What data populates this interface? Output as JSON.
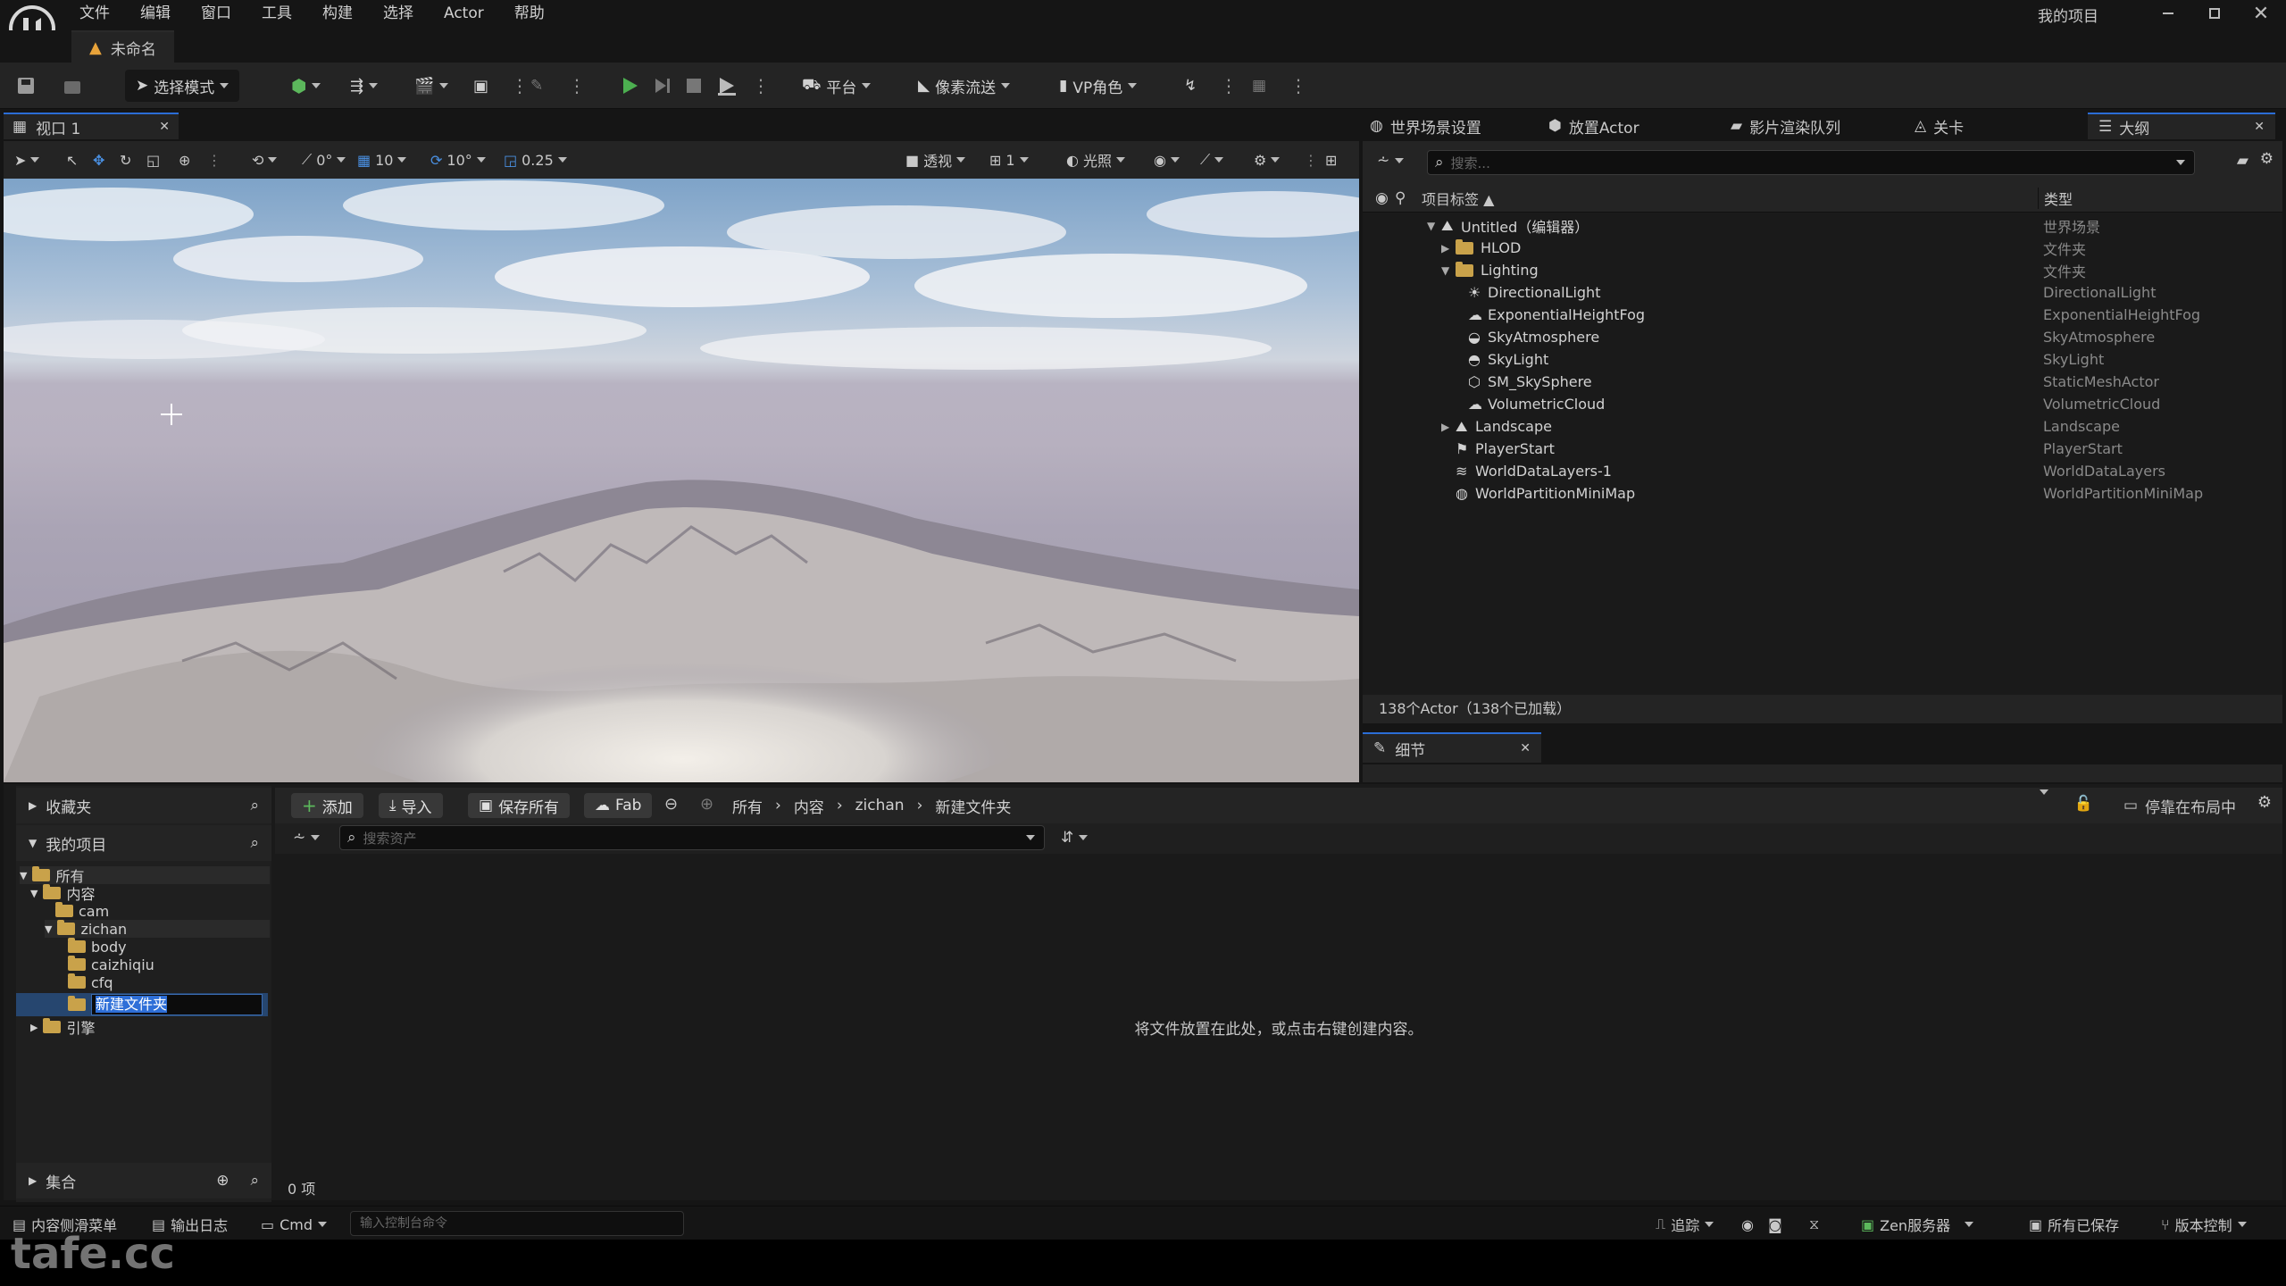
{
  "app": {
    "project_name": "我的项目",
    "document_tab": "未命名"
  },
  "menu": [
    "文件",
    "编辑",
    "窗口",
    "工具",
    "构建",
    "选择",
    "Actor",
    "帮助"
  ],
  "toolbar": {
    "select_mode": "选择模式",
    "platform": "平台",
    "pixel_streaming": "像素流送",
    "vp_role": "VP角色"
  },
  "viewport": {
    "tab_label": "视口 1",
    "snap_angle": "0°",
    "grid_size": "10",
    "rotation_snap": "10°",
    "scale_snap": "0.25",
    "view_mode": "透视",
    "layout_count": "1",
    "lighting": "光照"
  },
  "right_tabs": [
    "世界场景设置",
    "放置Actor",
    "影片渲染队列",
    "关卡",
    "大纲"
  ],
  "outliner": {
    "search_placeholder": "搜索...",
    "col_label": "项目标签 ▲",
    "col_type": "类型",
    "rows": [
      {
        "label": "Untitled（编辑器）",
        "type": "世界场景",
        "icon": "world-icon",
        "indent": 0
      },
      {
        "label": "HLOD",
        "type": "文件夹",
        "icon": "folder-icon",
        "indent": 1
      },
      {
        "label": "Lighting",
        "type": "文件夹",
        "icon": "folder-icon",
        "indent": 1
      },
      {
        "label": "DirectionalLight",
        "type": "DirectionalLight",
        "icon": "sun-icon",
        "indent": 2
      },
      {
        "label": "ExponentialHeightFog",
        "type": "ExponentialHeightFog",
        "icon": "fog-icon",
        "indent": 2
      },
      {
        "label": "SkyAtmosphere",
        "type": "SkyAtmosphere",
        "icon": "atmosphere-icon",
        "indent": 2
      },
      {
        "label": "SkyLight",
        "type": "SkyLight",
        "icon": "skylight-icon",
        "indent": 2
      },
      {
        "label": "SM_SkySphere",
        "type": "StaticMeshActor",
        "icon": "mesh-icon",
        "indent": 2
      },
      {
        "label": "VolumetricCloud",
        "type": "VolumetricCloud",
        "icon": "cloud-icon",
        "indent": 2
      },
      {
        "label": "Landscape",
        "type": "Landscape",
        "icon": "landscape-icon",
        "indent": 1
      },
      {
        "label": "PlayerStart",
        "type": "PlayerStart",
        "icon": "flag-icon",
        "indent": 1
      },
      {
        "label": "WorldDataLayers-1",
        "type": "WorldDataLayers",
        "icon": "layers-icon",
        "indent": 1
      },
      {
        "label": "WorldPartitionMiniMap",
        "type": "WorldPartitionMiniMap",
        "icon": "globe-icon",
        "indent": 1
      }
    ],
    "footer": "138个Actor（138个已加载）"
  },
  "details": {
    "tab_label": "细节"
  },
  "content_browser": {
    "favorites": "收藏夹",
    "my_project": "我的项目",
    "collections": "集合",
    "tree": {
      "all": "所有",
      "content": "内容",
      "cam": "cam",
      "zichan": "zichan",
      "body": "body",
      "caizhiqiu": "caizhiqiu",
      "cfq": "cfq",
      "new_folder": "新建文件夹",
      "engine": "引擎"
    },
    "add": "添加",
    "import": "导入",
    "save_all": "保存所有",
    "fab": "Fab",
    "breadcrumb": [
      "所有",
      "内容",
      "zichan",
      "新建文件夹"
    ],
    "dock": "停靠在布局中",
    "search_placeholder": "搜索资产",
    "empty_message": "将文件放置在此处，或点击右键创建内容。",
    "item_count": "0 项"
  },
  "statusbar": {
    "content_drawer": "内容侧滑菜单",
    "output_log": "输出日志",
    "cmd": "Cmd",
    "cmd_placeholder": "输入控制台命令",
    "trace": "追踪",
    "zen_server": "Zen服务器",
    "all_saved": "所有已保存",
    "source_control": "版本控制"
  },
  "watermark": "tafe.cc"
}
